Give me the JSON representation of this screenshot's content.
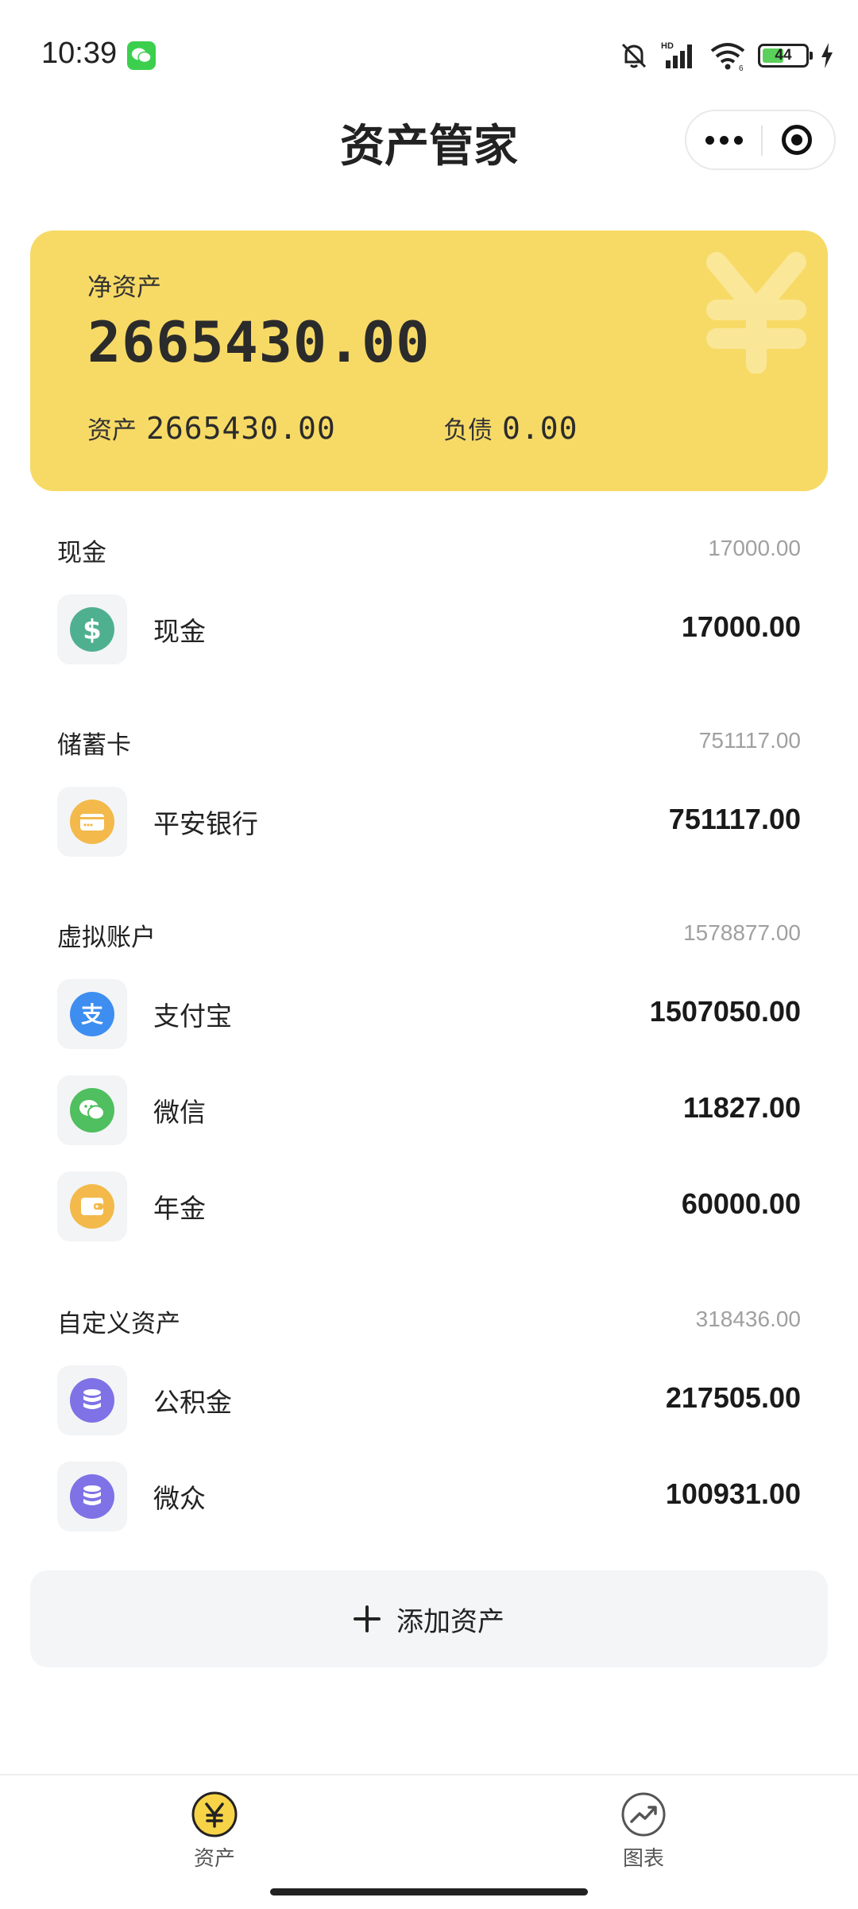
{
  "status_bar": {
    "time": "10:39",
    "battery_level": "44"
  },
  "header": {
    "title": "资产管家"
  },
  "summary": {
    "net_label": "净资产",
    "net_value": "2665430.00",
    "assets_label": "资产",
    "assets_value": "2665430.00",
    "debt_label": "负债",
    "debt_value": "0.00"
  },
  "sections": [
    {
      "title": "现金",
      "total": "17000.00",
      "items": [
        {
          "name": "现金",
          "value": "17000.00",
          "icon": "dollar-icon",
          "color": "#4fb08f"
        }
      ]
    },
    {
      "title": "储蓄卡",
      "total": "751117.00",
      "items": [
        {
          "name": "平安银行",
          "value": "751117.00",
          "icon": "bank-card-icon",
          "color": "#f3b94a"
        }
      ]
    },
    {
      "title": "虚拟账户",
      "total": "1578877.00",
      "items": [
        {
          "name": "支付宝",
          "value": "1507050.00",
          "icon": "alipay-icon",
          "color": "#3d8ef0"
        },
        {
          "name": "微信",
          "value": "11827.00",
          "icon": "wechat-icon",
          "color": "#4fbf5f"
        },
        {
          "name": "年金",
          "value": "60000.00",
          "icon": "wallet-icon",
          "color": "#f3b94a"
        }
      ]
    },
    {
      "title": "自定义资产",
      "total": "318436.00",
      "items": [
        {
          "name": "公积金",
          "value": "217505.00",
          "icon": "database-icon",
          "color": "#7e72e6"
        },
        {
          "name": "微众",
          "value": "100931.00",
          "icon": "database-icon",
          "color": "#7e72e6"
        }
      ]
    }
  ],
  "add_button": {
    "label": "添加资产"
  },
  "tabs": [
    {
      "label": "资产",
      "icon": "yen-icon",
      "active": true
    },
    {
      "label": "图表",
      "icon": "trend-chart-icon",
      "active": false
    }
  ],
  "colors": {
    "card": "#f7da66",
    "accent": "#f7d348"
  }
}
